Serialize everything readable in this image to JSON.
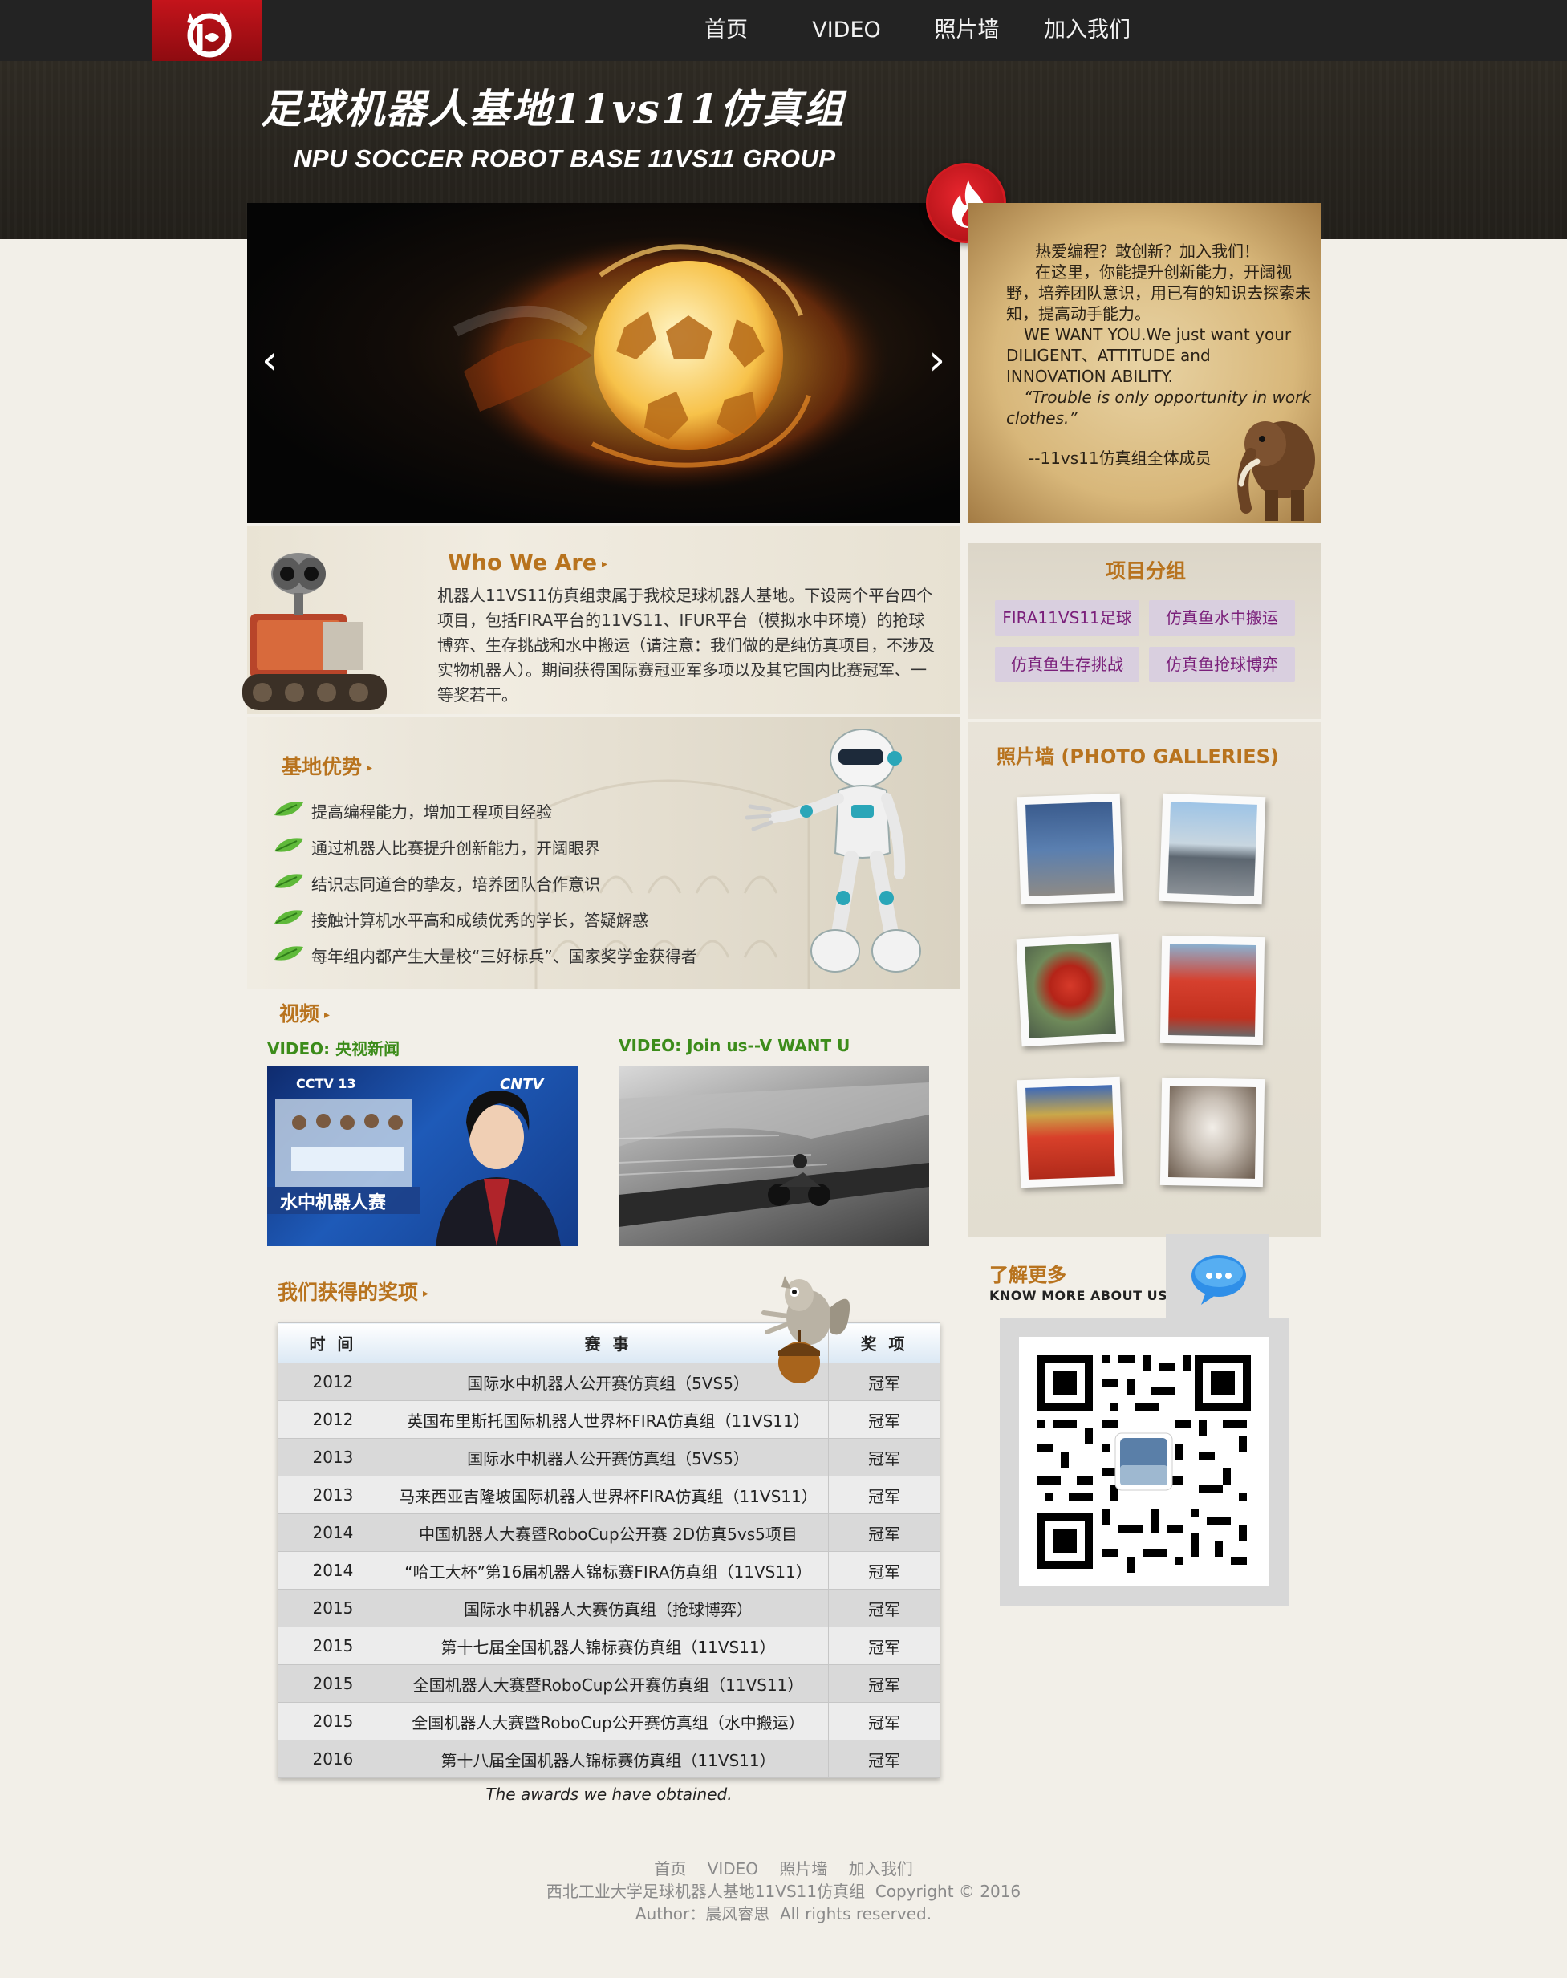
{
  "nav": {
    "items": [
      "首页",
      "VIDEO",
      "照片墙",
      "加入我们"
    ]
  },
  "header": {
    "title": "足球机器人基地11vs11仿真组",
    "subtitle": "NPU SOCCER ROBOT BASE 11VS11 GROUP"
  },
  "slider": {
    "prev": "‹",
    "next": "›"
  },
  "recruit": {
    "line1": "热爱编程？敢创新？加入我们！",
    "line2": "在这里，你能提升创新能力，开阔视野，培养团队意识，用已有的知识去探索未知，提高动手能力。",
    "line3": "WE WANT YOU.We just want your DILIGENT、ATTITUDE and INNOVATION ABILITY.",
    "line4": "“Trouble is only opportunity in work clothes.”",
    "sign": "--11vs11仿真组全体成员"
  },
  "who": {
    "title": "Who We Are",
    "text": "机器人11VS11仿真组隶属于我校足球机器人基地。下设两个平台四个项目，包括FIRA平台的11VS11、IFUR平台（模拟水中环境）的抢球博弈、生存挑战和水中搬运（请注意：我们做的是纯仿真项目，不涉及实物机器人）。期间获得国际赛冠亚军多项以及其它国内比赛冠军、一等奖若干。"
  },
  "groups": {
    "title": "项目分组",
    "items": [
      "FIRA11VS11足球",
      "仿真鱼水中搬运",
      "仿真鱼生存挑战",
      "仿真鱼抢球博弈"
    ]
  },
  "advantages": {
    "title": "基地优势",
    "items": [
      "提高编程能力，增加工程项目经验",
      "通过机器人比赛提升创新能力，开阔眼界",
      "结识志同道合的挚友，培养团队合作意识",
      "接触计算机水平高和成绩优秀的学长，答疑解惑",
      "每年组内都产生大量校“三好标兵”、国家奖学金获得者"
    ]
  },
  "videos": {
    "title": "视频",
    "items": [
      {
        "label": "VIDEO: 央视新闻",
        "caption": "水中机器人赛",
        "logo1": "CCTV 13",
        "logo2": "CNTV"
      },
      {
        "label": "VIDEO: Join us--V WANT U"
      }
    ]
  },
  "gallery": {
    "title": "照片墙 (PHOTO GALLERIES)"
  },
  "more": {
    "title": "了解更多",
    "subtitle": "KNOW MORE ABOUT US"
  },
  "awards": {
    "title": "我们获得的奖项",
    "headers": [
      "时 间",
      "赛 事",
      "奖 项"
    ],
    "rows": [
      [
        "2012",
        "国际水中机器人公开赛仿真组（5VS5）",
        "冠军"
      ],
      [
        "2012",
        "英国布里斯托国际机器人世界杯FIRA仿真组（11VS11）",
        "冠军"
      ],
      [
        "2013",
        "国际水中机器人公开赛仿真组（5VS5）",
        "冠军"
      ],
      [
        "2013",
        "马来西亚吉隆坡国际机器人世界杯FIRA仿真组（11VS11）",
        "冠军"
      ],
      [
        "2014",
        "中国机器人大赛暨RoboCup公开赛 2D仿真5vs5项目",
        "冠军"
      ],
      [
        "2014",
        "“哈工大杯”第16届机器人锦标赛FIRA仿真组（11VS11）",
        "冠军"
      ],
      [
        "2015",
        "国际水中机器人大赛仿真组（抢球博弈）",
        "冠军"
      ],
      [
        "2015",
        "第十七届全国机器人锦标赛仿真组（11VS11）",
        "冠军"
      ],
      [
        "2015",
        "全国机器人大赛暨RoboCup公开赛仿真组（11VS11）",
        "冠军"
      ],
      [
        "2015",
        "全国机器人大赛暨RoboCup公开赛仿真组（水中搬运）",
        "冠军"
      ],
      [
        "2016",
        "第十八届全国机器人锦标赛仿真组（11VS11）",
        "冠军"
      ]
    ],
    "caption": "The awards we have obtained."
  },
  "footer": {
    "nav": [
      "首页",
      "VIDEO",
      "照片墙",
      "加入我们"
    ],
    "copyright": "西北工业大学足球机器人基地11VS11仿真组  Copyright © 2016",
    "author": "Author：晨风睿思  All rights reserved."
  },
  "colors": {
    "nav_bg": "#232323",
    "banner_bg": "#2a2620",
    "logo_red": "#c4141b",
    "section_title": "#b8731e",
    "video_label": "#3c8c1a",
    "chip_text": "#7a1f7a",
    "chip_bg": "#d9cfdf",
    "page_bg": "#f2efe8"
  },
  "icons": [
    "cat-logo-icon",
    "flame-icon",
    "triangle-right-icon",
    "leaf-bullet-icon",
    "chat-bubble-icon",
    "qr-code"
  ]
}
